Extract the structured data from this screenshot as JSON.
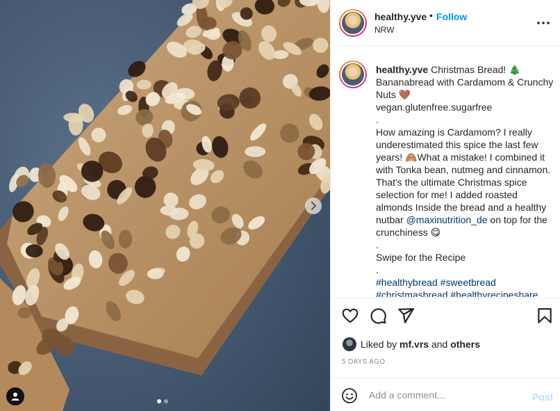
{
  "post": {
    "username": "healthy.yve",
    "separator": "•",
    "follow_label": "Follow",
    "location": "NRW"
  },
  "caption": {
    "username": "healthy.yve",
    "lines": [
      "Christmas Bread! 🎄",
      "Bananabread with Cardamom & Crunchy",
      "Nuts 🤎",
      "vegan.glutenfree.sugarfree",
      ".",
      "How amazing is Cardamom? I really",
      "underestimated this spice the last few",
      "years! 🙈What a mistake! I combined it",
      "with Tonka bean, nutmeg and cinnamon.",
      "That's the ultimate Christmas spice",
      "selection for me! I added roasted",
      "almonds Inside the bread and a healthy",
      "nutbar",
      "crunchiness 😋",
      ".",
      "Swipe for the Recipe",
      "."
    ],
    "mention": "@maxinutrition_de",
    "after_mention": "on top for the",
    "hashtags_line1": [
      "#healthybread",
      "#sweetbread"
    ],
    "hashtags_line2": [
      "#christmasbread",
      "#healthyrecipeshare"
    ]
  },
  "likes": {
    "prefix": "Liked by",
    "user": "mf.vrs",
    "and": "and",
    "others": "others"
  },
  "timestamp": "5 DAYS AGO",
  "comment": {
    "placeholder": "Add a comment...",
    "post_label": "Post"
  },
  "carousel": {
    "total": 2,
    "active": 1
  },
  "icons": {
    "more": "more-options-icon",
    "like": "heart-icon",
    "comment": "comment-bubble-icon",
    "share": "paper-plane-icon",
    "save": "bookmark-icon",
    "emoji": "smiley-icon",
    "next": "chevron-right-icon",
    "tags": "user-tag-icon"
  },
  "colors": {
    "follow": "#0095f6",
    "link": "#00376b",
    "muted": "#8e8e8e",
    "post_disabled": "#b2dffc"
  }
}
